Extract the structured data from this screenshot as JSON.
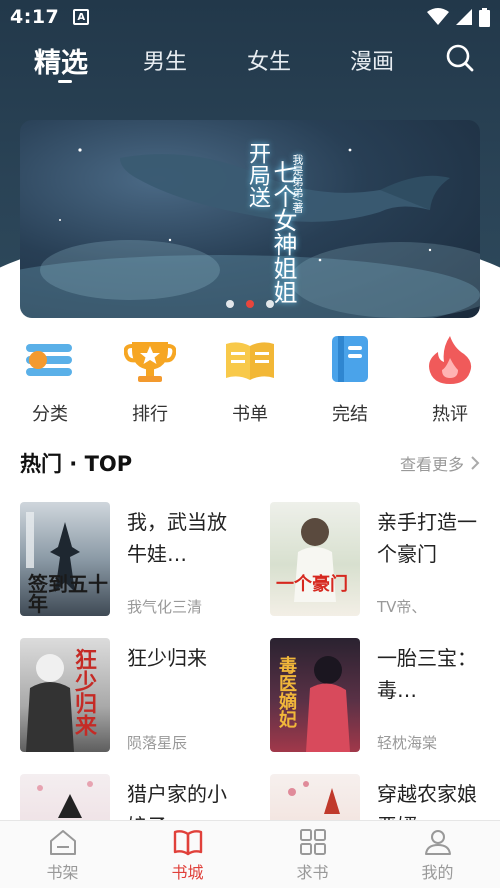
{
  "status": {
    "time": "4:17",
    "badge": "A"
  },
  "tabs": [
    {
      "label": "精选",
      "active": true
    },
    {
      "label": "男生"
    },
    {
      "label": "女生"
    },
    {
      "label": "漫画"
    }
  ],
  "banner": {
    "line1": "开局送",
    "line2": "七个女神姐姐",
    "line3": "我是弟弟/著",
    "dots": 3,
    "active_dot": 1
  },
  "categories": [
    {
      "label": "分类",
      "icon": "category-icon"
    },
    {
      "label": "排行",
      "icon": "trophy-icon"
    },
    {
      "label": "书单",
      "icon": "book-list-icon"
    },
    {
      "label": "完结",
      "icon": "finished-icon"
    },
    {
      "label": "热评",
      "icon": "flame-icon"
    }
  ],
  "section": {
    "title": "热门 · TOP",
    "more": "查看更多"
  },
  "books": [
    {
      "title": "我，武当放牛娃…",
      "author": "我气化三清",
      "cover_text": "签到五十年"
    },
    {
      "title": "亲手打造一个豪门",
      "author": "TV帝、",
      "cover_text": "一个豪门"
    },
    {
      "title": "狂少归来",
      "author": "陨落星辰",
      "cover_text": "狂少归来"
    },
    {
      "title": "一胎三宝：毒…",
      "author": "轻枕海棠",
      "cover_text": "毒医嫡妃"
    },
    {
      "title": "猎户家的小娘子",
      "author": "",
      "cover_text": ""
    },
    {
      "title": "穿越农家娘恶婿",
      "author": "",
      "cover_text": ""
    }
  ],
  "bottom_nav": [
    {
      "label": "书架",
      "icon": "bookshelf-icon"
    },
    {
      "label": "书城",
      "icon": "bookstore-icon",
      "active": true
    },
    {
      "label": "求书",
      "icon": "request-icon"
    },
    {
      "label": "我的",
      "icon": "profile-icon"
    }
  ],
  "colors": {
    "accent": "#e0403a",
    "header": "#2a4356"
  }
}
